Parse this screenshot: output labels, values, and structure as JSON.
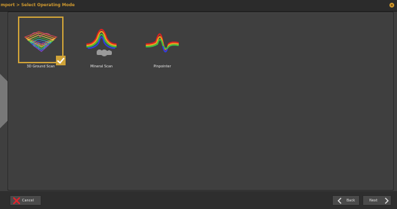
{
  "header": {
    "breadcrumb": "mport > Select Operating Mode",
    "close_icon": "close-icon"
  },
  "modes": [
    {
      "label": "3D Ground Scan",
      "icon": "3d-ground-scan-icon",
      "selected": true
    },
    {
      "label": "Mineral Scan",
      "icon": "mineral-scan-icon",
      "selected": false
    },
    {
      "label": "Pinpointer",
      "icon": "pinpointer-icon",
      "selected": false
    }
  ],
  "footer": {
    "cancel_label": "Cancel",
    "back_label": "Back",
    "next_label": "Next"
  },
  "colors": {
    "accent": "#d0a338",
    "background": "#3f3f3f",
    "titlebar": "#2b2b2b",
    "cancel_x": "#e0242c"
  }
}
